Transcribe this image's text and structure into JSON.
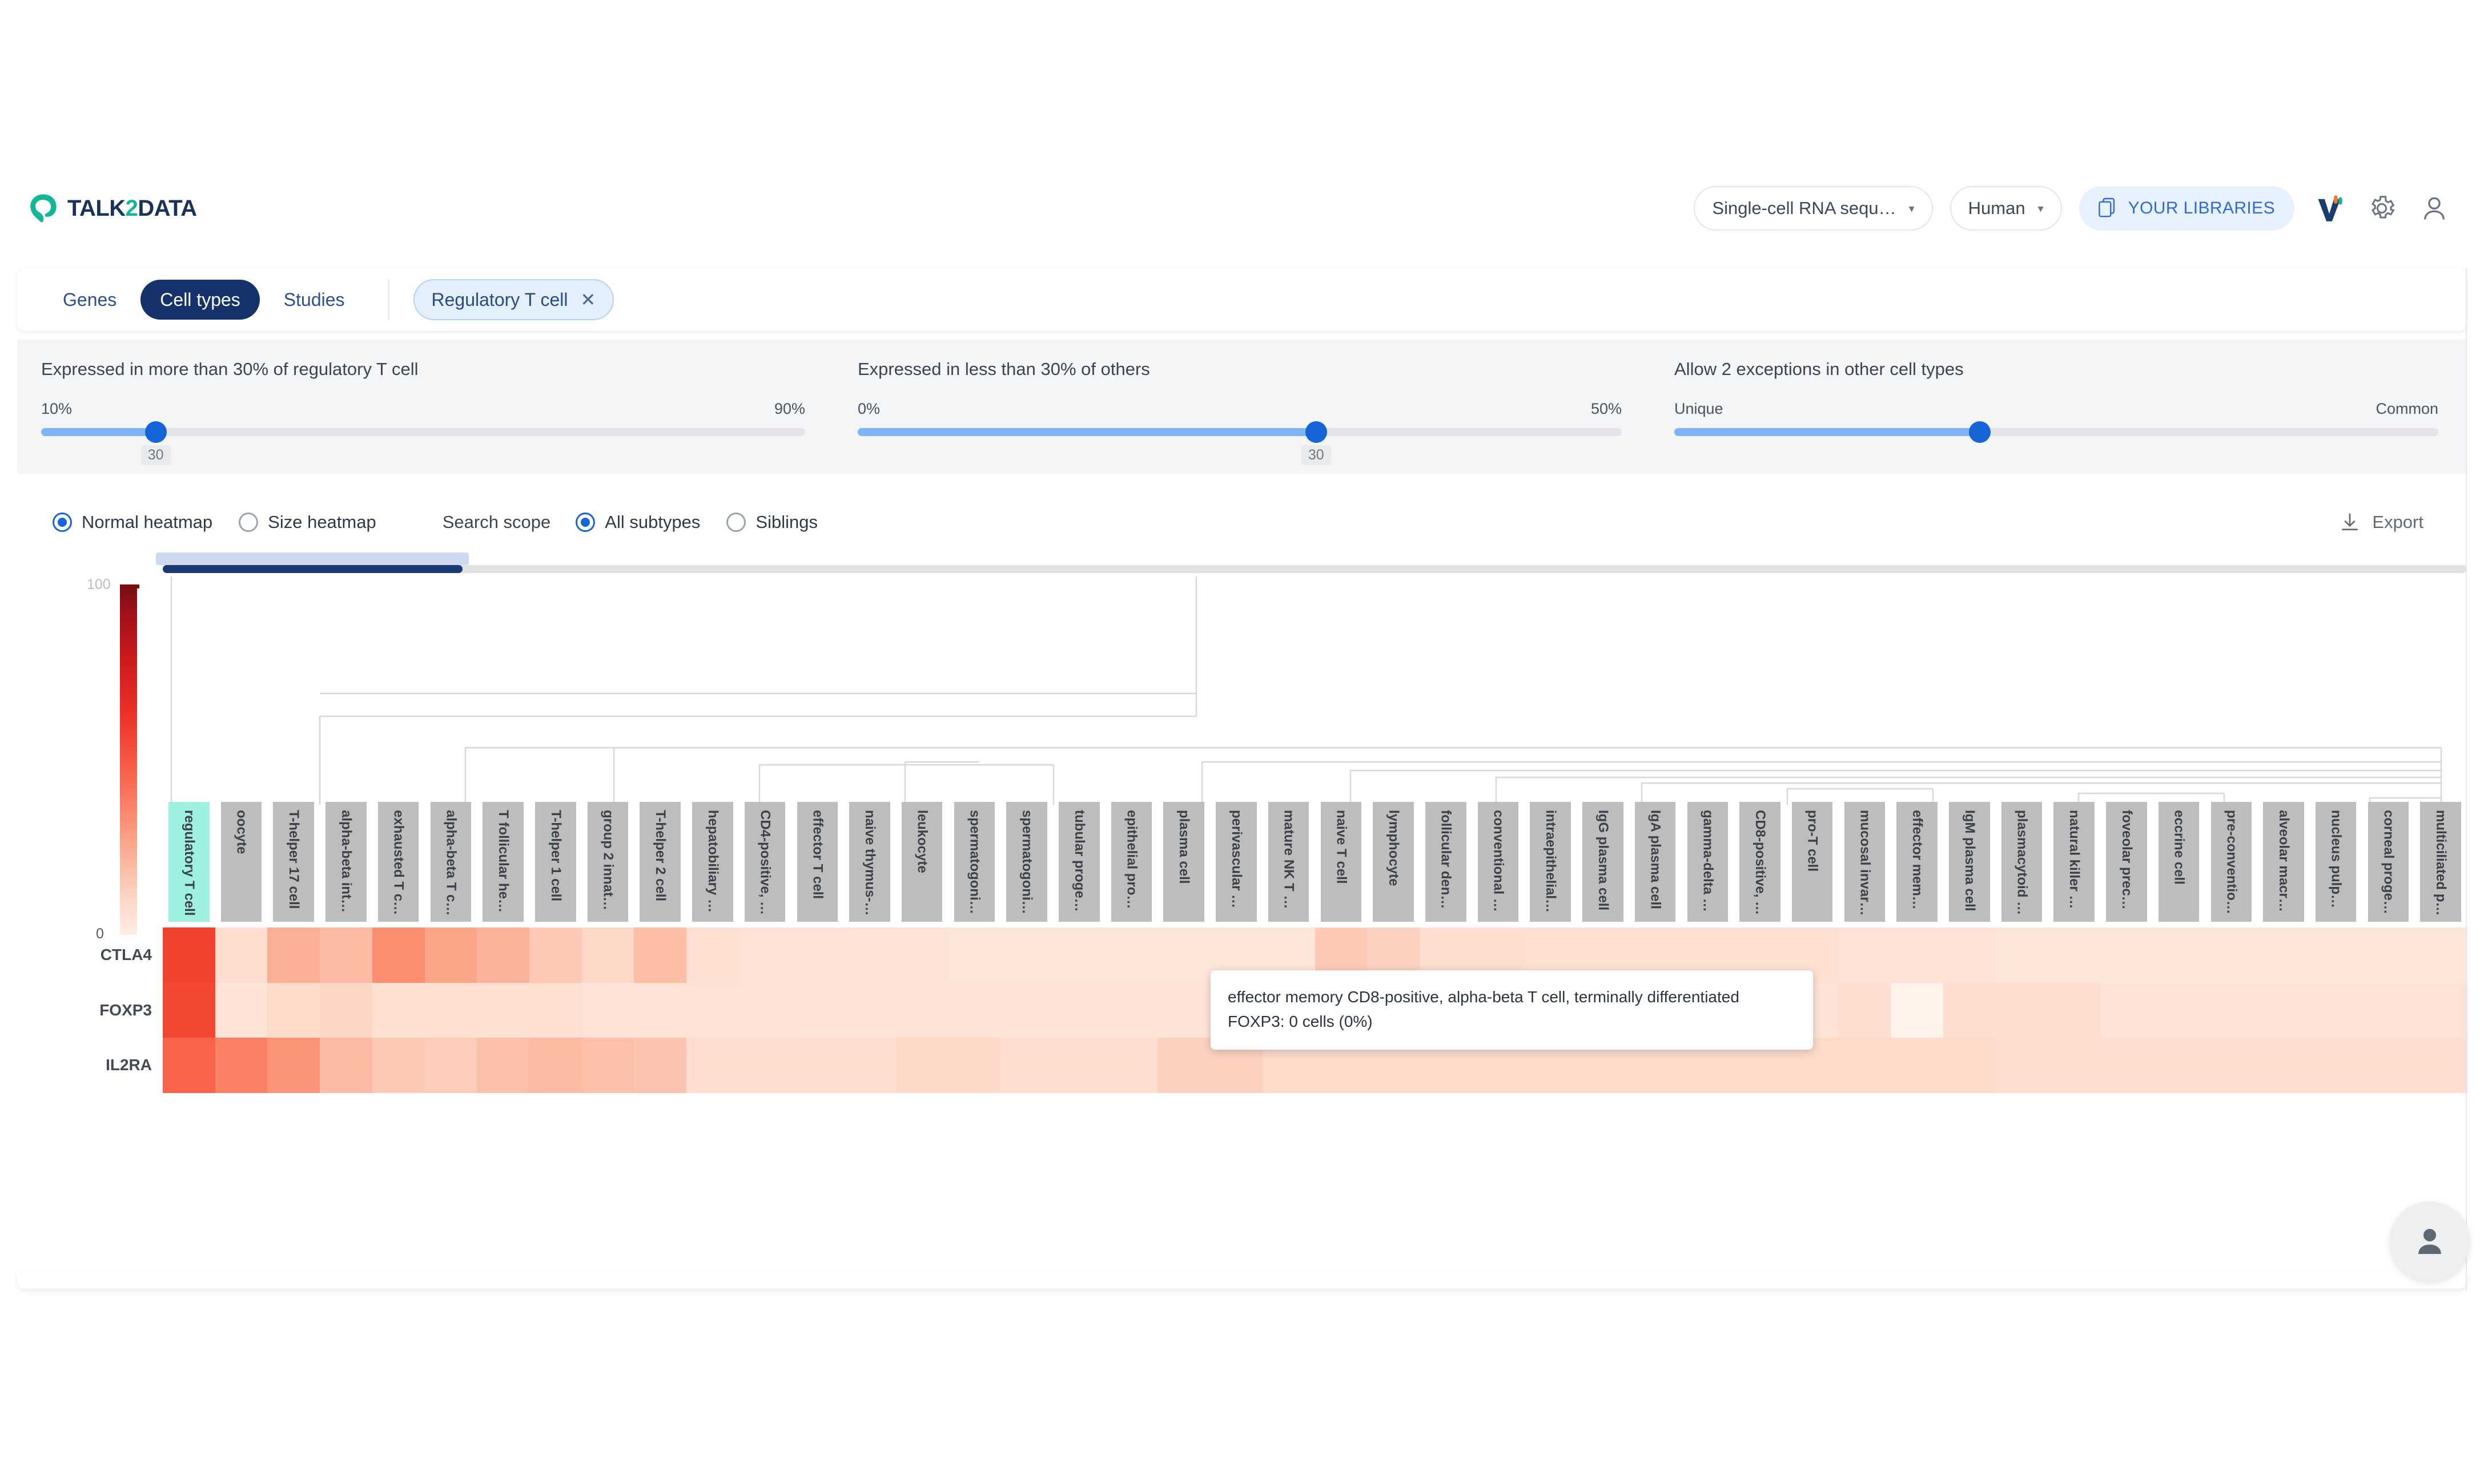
{
  "app": {
    "logo_text_1": "TALK",
    "logo_text_2": "2",
    "logo_text_3": "DATA"
  },
  "header": {
    "assay_select": "Single-cell RNA sequ…",
    "organism_select": "Human",
    "libraries_button": "YOUR LIBRARIES",
    "caret": "▾",
    "icons": [
      "logo-v-icon",
      "gear-icon",
      "user-icon"
    ]
  },
  "tabs": {
    "items": [
      {
        "label": "Genes",
        "active": false
      },
      {
        "label": "Cell types",
        "active": true
      },
      {
        "label": "Studies",
        "active": false
      }
    ],
    "chip": {
      "label": "Regulatory T cell",
      "close": "✕"
    }
  },
  "filters": [
    {
      "title": "Expressed in more than 30% of regulatory T cell",
      "left_label": "10%",
      "right_label": "90%",
      "value": "30",
      "fill_pct": 15
    },
    {
      "title": "Expressed in less than 30% of others",
      "left_label": "0%",
      "right_label": "50%",
      "value": "30",
      "fill_pct": 60
    },
    {
      "title": "Allow 2 exceptions in other cell types",
      "left_label": "Unique",
      "right_label": "Common",
      "value": "",
      "fill_pct": 40
    }
  ],
  "options": {
    "heatmap_modes": [
      {
        "label": "Normal heatmap",
        "selected": true
      },
      {
        "label": "Size heatmap",
        "selected": false
      }
    ],
    "scope_label": "Search scope",
    "scope_modes": [
      {
        "label": "All subtypes",
        "selected": true
      },
      {
        "label": "Siblings",
        "selected": false
      }
    ],
    "export_label": "Export"
  },
  "legend": {
    "max": "100",
    "min": "0"
  },
  "tooltip": {
    "line1": "effector memory CD8-positive, alpha-beta T cell, terminally differentiated",
    "line2": "FOXP3: 0 cells (0%)"
  },
  "chart_data": {
    "type": "heatmap",
    "title": "",
    "xlabel": "",
    "ylabel": "",
    "colorscale": {
      "min": 0,
      "max": 100,
      "low_color": "#ffeee6",
      "high_color": "#7a0d12"
    },
    "genes": [
      "CTLA4",
      "FOXP3",
      "IL2RA"
    ],
    "categories": [
      "regulatory T cell",
      "oocyte",
      "T-helper 17 cell",
      "alpha-beta intraep…",
      "exhausted T cell",
      "alpha-beta T cell",
      "T follicular helpe…",
      "T-helper 1 cell",
      "group 2 innate lym…",
      "T-helper 2 cell",
      "hepatobiliary hybr…",
      "CD4-positive, alph…",
      "effector T cell",
      "naive thymus-deriv…",
      "leukocyte",
      "spermatogonium",
      "spermatogonial ste…",
      "tubular progenitor…",
      "epithelial progeni…",
      "plasma cell",
      "perivascular macro…",
      "mature NK T cell",
      "naive T cell",
      "lymphocyte",
      "follicular dendrit…",
      "conventional dendr…",
      "intraepithelial ly…",
      "IgG plasma cell",
      "IgA plasma cell",
      "gamma-delta T cell",
      "CD8-positive, alph…",
      "pro-T cell",
      "mucosal invariant …",
      "effector memory CD…",
      "IgM plasma cell",
      "plasmacytoid dendr…",
      "natural killer cell",
      "foveolar precursor",
      "eccrine cell",
      "pre-conventional d…",
      "alveolar macrophage",
      "nucleus pulposus p…",
      "corneal progenitor",
      "multiciliated prec…"
    ],
    "series": [
      {
        "name": "CTLA4",
        "values": [
          72,
          14,
          34,
          30,
          46,
          38,
          33,
          24,
          17,
          29,
          13,
          12,
          12,
          11,
          11,
          10,
          10,
          10,
          10,
          10,
          10,
          10,
          24,
          20,
          14,
          14,
          13,
          13,
          13,
          13,
          13,
          13,
          12,
          12,
          12,
          10,
          10,
          10,
          10,
          10,
          10,
          10,
          10,
          10
        ]
      },
      {
        "name": "FOXP3",
        "values": [
          70,
          11,
          16,
          18,
          13,
          13,
          13,
          13,
          12,
          12,
          12,
          12,
          11,
          11,
          11,
          11,
          11,
          11,
          11,
          11,
          11,
          11,
          11,
          11,
          11,
          11,
          11,
          11,
          11,
          11,
          11,
          11,
          14,
          3,
          14,
          14,
          14,
          12,
          12,
          12,
          12,
          12,
          12,
          12
        ]
      },
      {
        "name": "IL2RA",
        "values": [
          60,
          50,
          44,
          30,
          24,
          22,
          28,
          30,
          28,
          26,
          14,
          14,
          14,
          14,
          17,
          17,
          14,
          14,
          14,
          20,
          20,
          16,
          16,
          16,
          16,
          16,
          16,
          16,
          16,
          16,
          16,
          16,
          16,
          16,
          16,
          14,
          14,
          14,
          14,
          14,
          14,
          14,
          14,
          14
        ]
      }
    ],
    "highlighted_cell": {
      "gene": "FOXP3",
      "category": "effector memory CD…",
      "value": 0,
      "label": "FOXP3: 0 cells (0%)"
    },
    "focused_category": "regulatory T cell",
    "legend": {
      "position": "left",
      "max": 100,
      "min": 0
    },
    "grid": false
  }
}
